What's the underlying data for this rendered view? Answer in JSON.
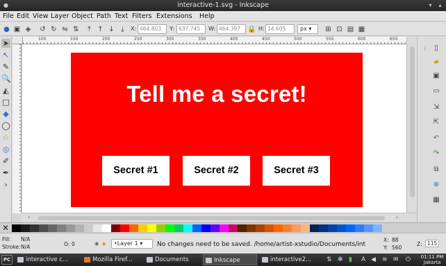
{
  "window": {
    "title": "interactive-1.svg - Inkscape"
  },
  "menu": [
    "File",
    "Edit",
    "View",
    "Layer",
    "Object",
    "Path",
    "Text",
    "Filters",
    "Extensions",
    "Help"
  ],
  "controls": {
    "x_label": "X:",
    "x_value": "464.803",
    "y_label": "Y:",
    "y_value": "637.745",
    "w_label": "W:",
    "w_value": "464.397",
    "h_label": "H:",
    "h_value": "14.605",
    "unit": "px"
  },
  "ruler_labels": [
    "100",
    "150",
    "200",
    "250",
    "300",
    "350",
    "400",
    "450",
    "500",
    "550",
    "600",
    "650"
  ],
  "canvas": {
    "headline": "Tell me a secret!",
    "secrets": [
      "Secret #1",
      "Secret #2",
      "Secret #3"
    ],
    "background_color": "#ff0000"
  },
  "status": {
    "fill_label": "Fill:",
    "fill_value": "N/A",
    "stroke_label": "Stroke:",
    "stroke_value": "N/A",
    "opacity_label": "O:",
    "opacity_value": "0",
    "layer": "•Layer 1",
    "message": "No changes need to be saved. /home/artist-xstudio/Documents/inter...",
    "cursor_x_label": "X:",
    "cursor_x": "88",
    "cursor_y_label": "Y:",
    "cursor_y": "560",
    "zoom_label": "Z:",
    "zoom": "115"
  },
  "taskbar": {
    "items": [
      "interactive c...",
      "Mozilla Firef...",
      "Documents",
      "Inkscape",
      "interactive2..."
    ],
    "clock_time": "01:11 PM",
    "clock_zone": "Jakarta"
  }
}
